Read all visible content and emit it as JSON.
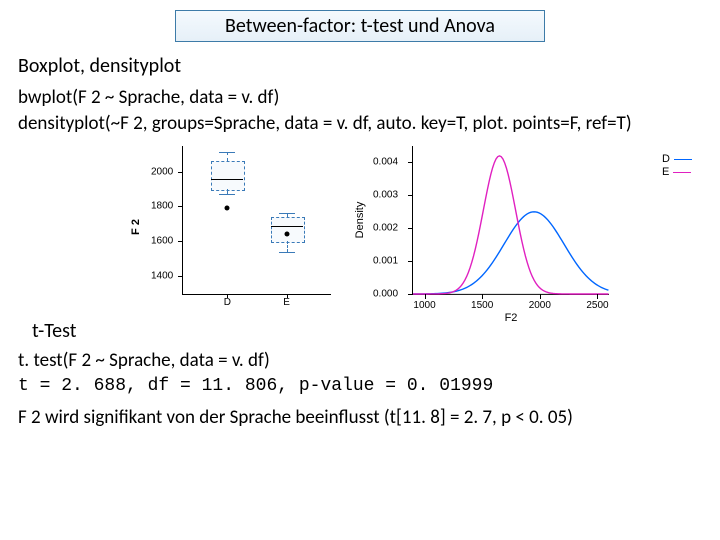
{
  "title": "Between-factor: t-test und Anova",
  "section1": "Boxplot, densityplot",
  "code1a": "bwplot(F 2 ~ Sprache, data = v. df)",
  "code1b": "densityplot(~F 2, groups=Sprache, data = v. df, auto. key=T, plot. points=F, ref=T)",
  "legend": {
    "a": "D",
    "b": "E"
  },
  "section2": "t-Test",
  "code2": "t. test(F 2 ~ Sprache, data = v. df)",
  "result": "t = 2. 688, df = 11. 806, p-value = 0. 01999",
  "conclusion": "F 2 wird signifikant von der Sprache beeinflusst (t[11. 8] = 2. 7, p < 0. 05)",
  "chart_data": [
    {
      "type": "boxplot",
      "ylabel": "F 2",
      "yticks": [
        1400,
        1600,
        1800,
        2000
      ],
      "ylim": [
        1300,
        2150
      ],
      "categories": [
        "D",
        "E"
      ],
      "boxes": [
        {
          "q1": 1900,
          "median": 1960,
          "q3": 2060,
          "whisker_low": 1870,
          "whisker_high": 2110,
          "outliers": [
            1790
          ]
        },
        {
          "q1": 1600,
          "median": 1690,
          "q3": 1740,
          "whisker_low": 1540,
          "whisker_high": 1760,
          "outliers": [
            1640
          ]
        }
      ]
    },
    {
      "type": "density",
      "xlabel": "F2",
      "ylabel": "Density",
      "xlim": [
        900,
        2600
      ],
      "xticks": [
        1000,
        1500,
        2000,
        2500
      ],
      "ylim": [
        0,
        0.0045
      ],
      "yticks": [
        0.0,
        0.001,
        0.002,
        0.003,
        0.004
      ],
      "series": [
        {
          "name": "D",
          "color": "#0066ff",
          "peak_x": 1950,
          "peak_y": 0.0025,
          "spread": 260
        },
        {
          "name": "E",
          "color": "#e020c0",
          "peak_x": 1650,
          "peak_y": 0.0042,
          "spread": 140
        }
      ]
    }
  ]
}
